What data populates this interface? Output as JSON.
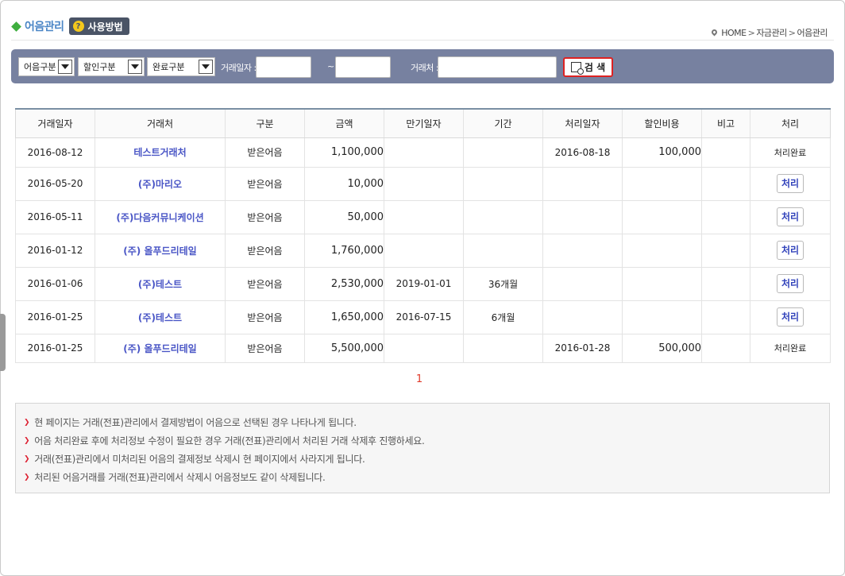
{
  "header": {
    "title": "어음관리",
    "help_label": "사용방법",
    "help_glyph": "?",
    "breadcrumb": [
      "HOME",
      "자금관리",
      "어음관리"
    ]
  },
  "search": {
    "filters": [
      "어음구분",
      "할인구분",
      "완료구분"
    ],
    "trade_date_label": "거래일자 :",
    "range_sep": "~",
    "partner_label": "거래처 :",
    "search_button": "검 색"
  },
  "table": {
    "headers": [
      "거래일자",
      "거래처",
      "구분",
      "금액",
      "만기일자",
      "기간",
      "처리일자",
      "할인비용",
      "비고",
      "처리"
    ],
    "rows": [
      {
        "date": "2016-08-12",
        "partner": "테스트거래처",
        "type": "받은어음",
        "amount": "1,100,000",
        "due": "",
        "period": "",
        "processed": "2016-08-18",
        "discount": "100,000",
        "note": "",
        "action": "처리완료",
        "done": true
      },
      {
        "date": "2016-05-20",
        "partner": "(주)마리오",
        "type": "받은어음",
        "amount": "10,000",
        "due": "",
        "period": "",
        "processed": "",
        "discount": "",
        "note": "",
        "action": "처리",
        "done": false
      },
      {
        "date": "2016-05-11",
        "partner": "(주)다음커뮤니케이션",
        "type": "받은어음",
        "amount": "50,000",
        "due": "",
        "period": "",
        "processed": "",
        "discount": "",
        "note": "",
        "action": "처리",
        "done": false
      },
      {
        "date": "2016-01-12",
        "partner": "(주) 올푸드리테일",
        "type": "받은어음",
        "amount": "1,760,000",
        "due": "",
        "period": "",
        "processed": "",
        "discount": "",
        "note": "",
        "action": "처리",
        "done": false
      },
      {
        "date": "2016-01-06",
        "partner": "(주)테스트",
        "type": "받은어음",
        "amount": "2,530,000",
        "due": "2019-01-01",
        "period": "36개월",
        "processed": "",
        "discount": "",
        "note": "",
        "action": "처리",
        "done": false
      },
      {
        "date": "2016-01-25",
        "partner": "(주)테스트",
        "type": "받은어음",
        "amount": "1,650,000",
        "due": "2016-07-15",
        "period": "6개월",
        "processed": "",
        "discount": "",
        "note": "",
        "action": "처리",
        "done": false
      },
      {
        "date": "2016-01-25",
        "partner": "(주) 올푸드리테일",
        "type": "받은어음",
        "amount": "5,500,000",
        "due": "",
        "period": "",
        "processed": "2016-01-28",
        "discount": "500,000",
        "note": "",
        "action": "처리완료",
        "done": true
      }
    ]
  },
  "pagination": {
    "current": "1"
  },
  "notices": [
    "현 페이지는 거래(전표)관리에서 결제방법이 어음으로 선택된 경우 나타나게 됩니다.",
    "어음 처리완료 후에 처리정보 수정이 필요한 경우 거래(전표)관리에서 처리된 거래 삭제후 진행하세요.",
    "거래(전표)관리에서 미처리된 어음의 결제정보 삭제시 현 페이지에서 사라지게 됩니다.",
    "처리된 어음거래를 거래(전표)관리에서 삭제시 어음정보도 같이 삭제됩니다."
  ],
  "colors": {
    "accent": "#4b86c6",
    "search_bar": "#7781a0",
    "link": "#4a56c6",
    "alert": "#e03a2a"
  }
}
